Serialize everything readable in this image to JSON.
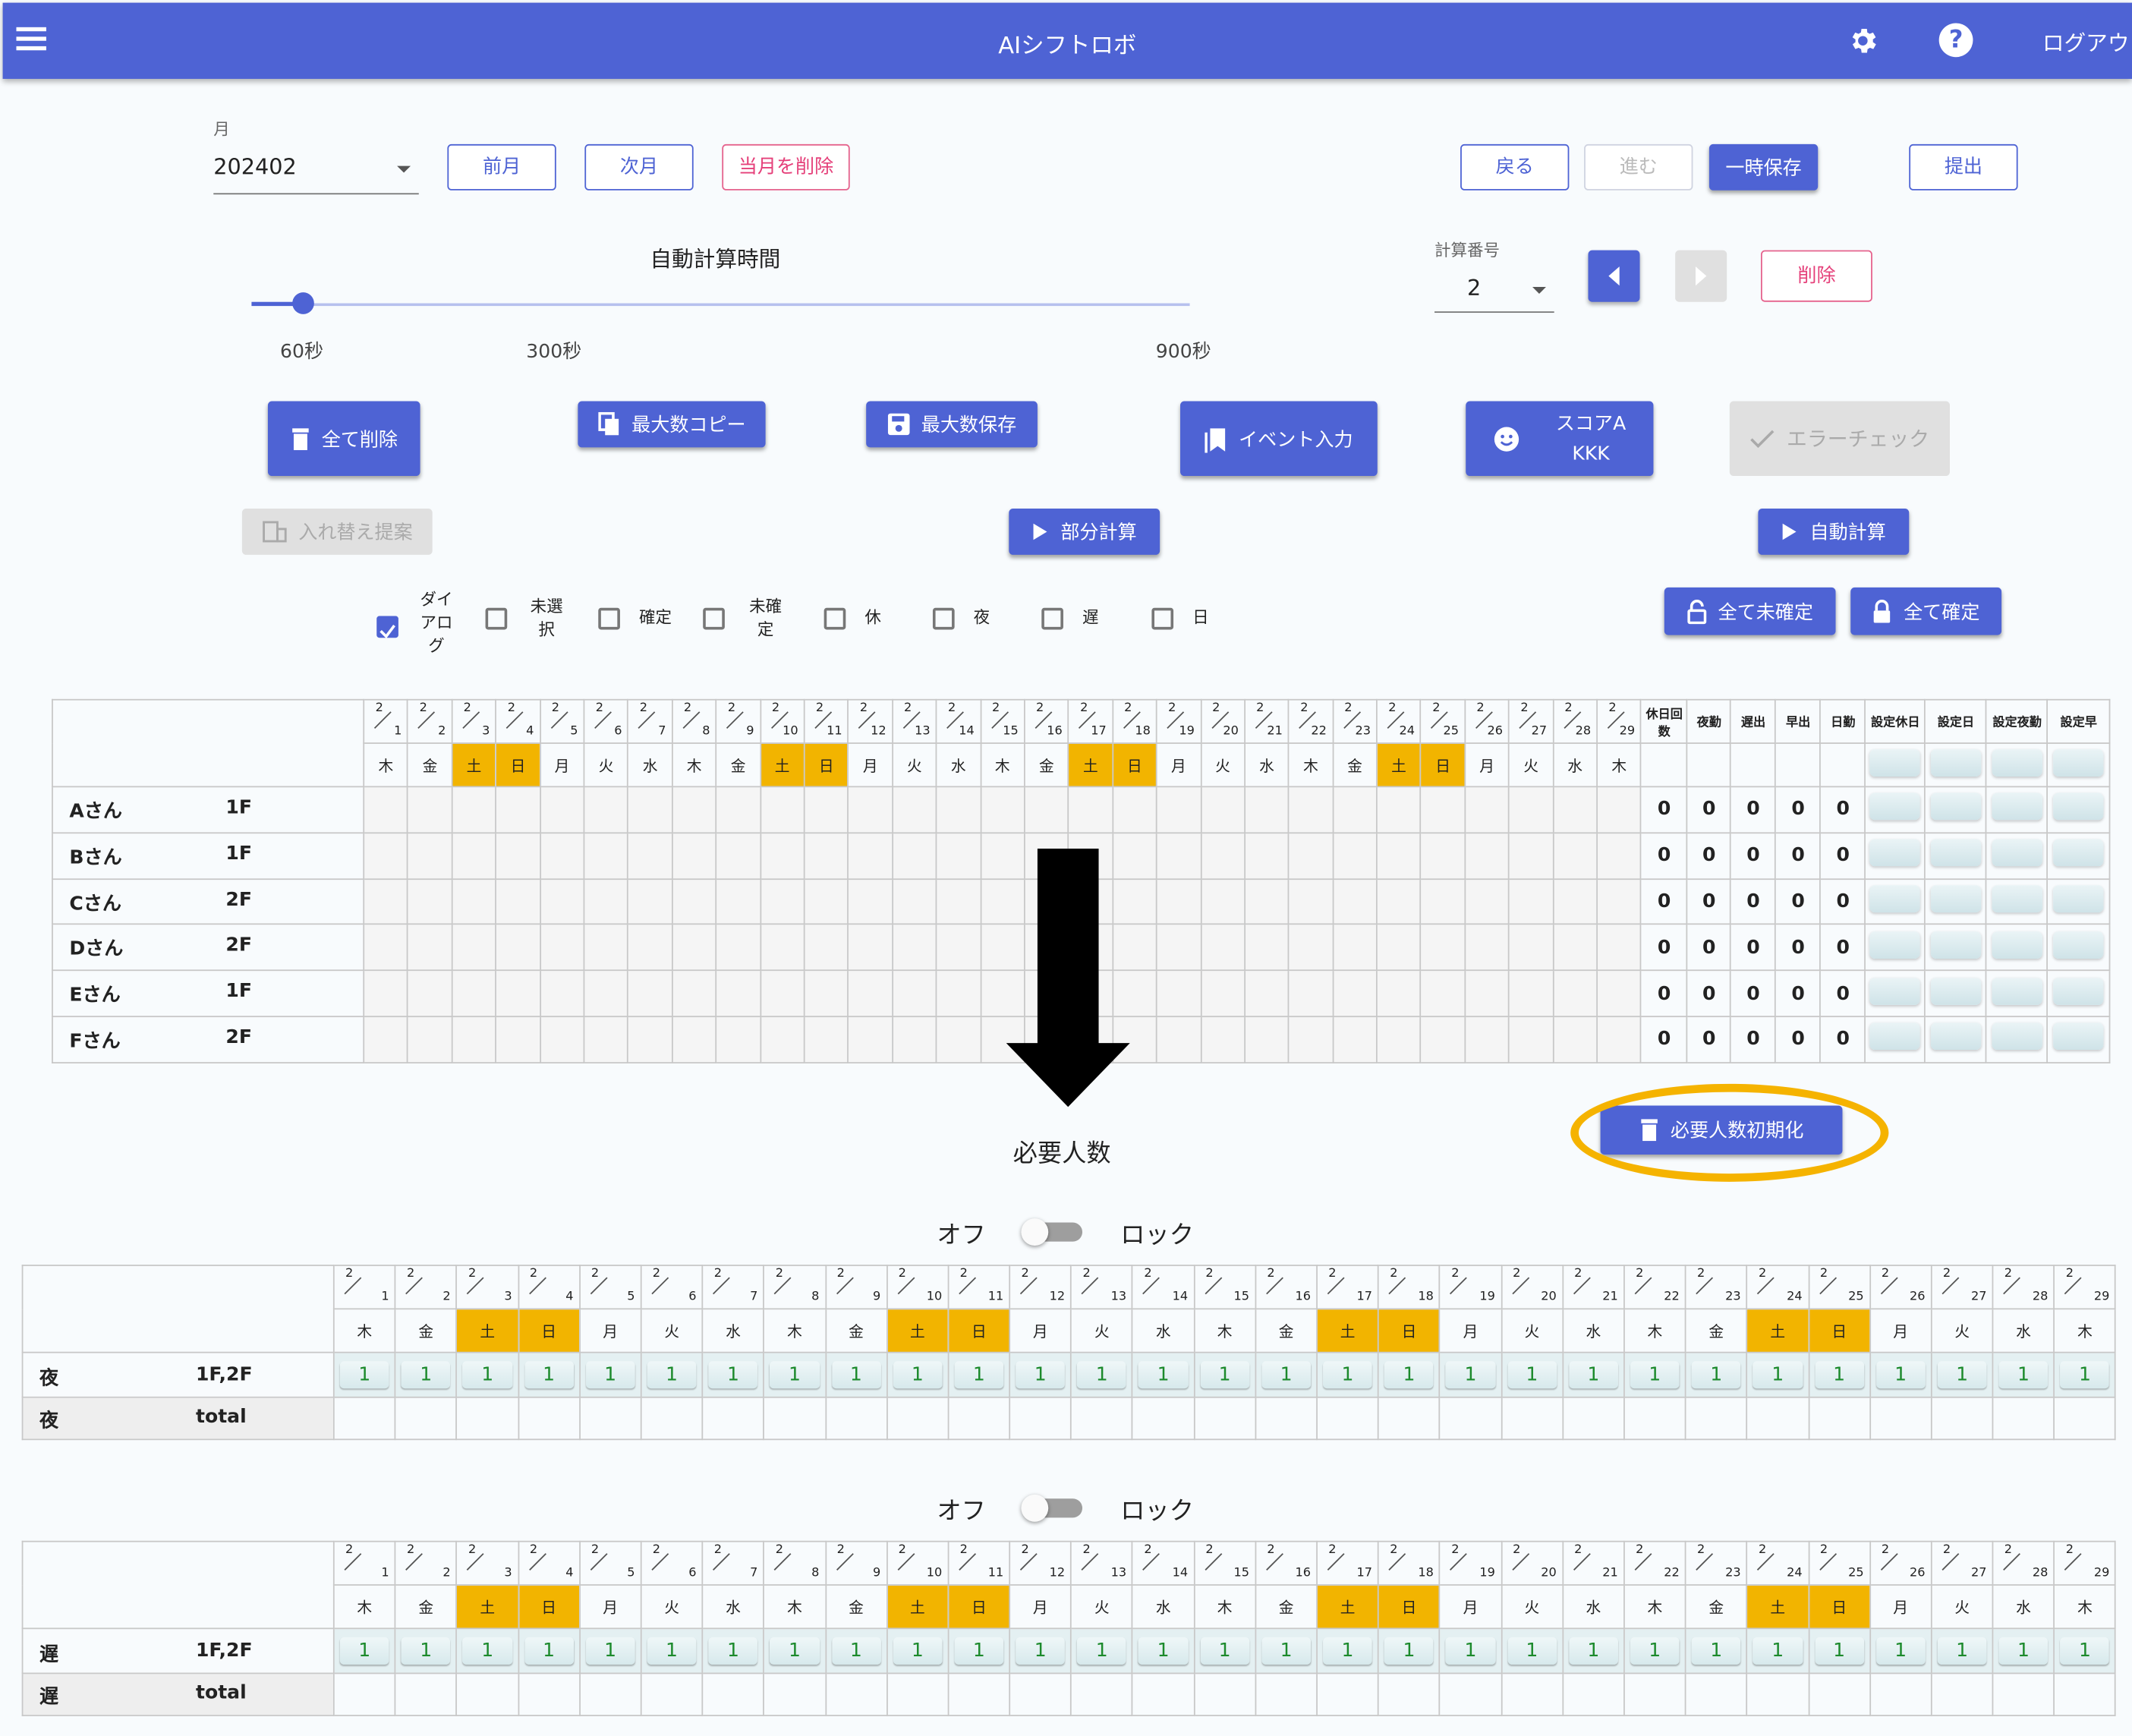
{
  "app": {
    "title": "AIシフトロボ",
    "logout": "ログアウ"
  },
  "month": {
    "label": "月",
    "value": "202402"
  },
  "buttons": {
    "prev_month": "前月",
    "next_month": "次月",
    "delete_month": "当月を削除",
    "back": "戻る",
    "forward": "進む",
    "save_temp": "一時保存",
    "submit": "提出",
    "delete_calc": "削除",
    "delete_all": "全て削除",
    "copy_max": "最大数コピー",
    "save_max": "最大数保存",
    "event_input": "イベント入力",
    "score_a": "スコアA",
    "score_b": "KKK",
    "error_check": "エラーチェック",
    "swap": "入れ替え提案",
    "partial_calc": "部分計算",
    "auto_calc": "自動計算",
    "all_unconfirm": "全て未確定",
    "all_confirm": "全て確定",
    "reset_required": "必要人数初期化"
  },
  "slider": {
    "title": "自動計算時間",
    "ticks": [
      "60秒",
      "300秒",
      "900秒"
    ],
    "value_sec": 60
  },
  "calc_no": {
    "label": "計算番号",
    "value": "2"
  },
  "filters": [
    {
      "label": "ダイアログ",
      "checked": true
    },
    {
      "label": "未選択",
      "checked": false
    },
    {
      "label": "確定",
      "checked": false
    },
    {
      "label": "未確定",
      "checked": false
    },
    {
      "label": "休",
      "checked": false
    },
    {
      "label": "夜",
      "checked": false
    },
    {
      "label": "遅",
      "checked": false
    },
    {
      "label": "日",
      "checked": false
    }
  ],
  "month_num": "2",
  "days": [
    {
      "d": "1",
      "w": "木"
    },
    {
      "d": "2",
      "w": "金"
    },
    {
      "d": "3",
      "w": "土",
      "we": true
    },
    {
      "d": "4",
      "w": "日",
      "we": true
    },
    {
      "d": "5",
      "w": "月"
    },
    {
      "d": "6",
      "w": "火"
    },
    {
      "d": "7",
      "w": "水"
    },
    {
      "d": "8",
      "w": "木"
    },
    {
      "d": "9",
      "w": "金"
    },
    {
      "d": "10",
      "w": "土",
      "we": true
    },
    {
      "d": "11",
      "w": "日",
      "we": true
    },
    {
      "d": "12",
      "w": "月"
    },
    {
      "d": "13",
      "w": "火"
    },
    {
      "d": "14",
      "w": "水"
    },
    {
      "d": "15",
      "w": "木"
    },
    {
      "d": "16",
      "w": "金"
    },
    {
      "d": "17",
      "w": "土",
      "we": true
    },
    {
      "d": "18",
      "w": "日",
      "we": true
    },
    {
      "d": "19",
      "w": "月"
    },
    {
      "d": "20",
      "w": "火"
    },
    {
      "d": "21",
      "w": "水"
    },
    {
      "d": "22",
      "w": "木"
    },
    {
      "d": "23",
      "w": "金"
    },
    {
      "d": "24",
      "w": "土",
      "we": true
    },
    {
      "d": "25",
      "w": "日",
      "we": true
    },
    {
      "d": "26",
      "w": "月"
    },
    {
      "d": "27",
      "w": "火"
    },
    {
      "d": "28",
      "w": "水"
    },
    {
      "d": "29",
      "w": "木"
    }
  ],
  "shift": {
    "stat_headers": [
      "休日回数",
      "夜勤",
      "遅出",
      "早出",
      "日勤"
    ],
    "setting_headers": [
      "設定休日",
      "設定日",
      "設定夜勤",
      "設定早"
    ],
    "staff": [
      {
        "name": "Aさん",
        "floor": "1F",
        "stats": [
          "0",
          "0",
          "0",
          "0",
          "0"
        ]
      },
      {
        "name": "Bさん",
        "floor": "1F",
        "stats": [
          "0",
          "0",
          "0",
          "0",
          "0"
        ]
      },
      {
        "name": "Cさん",
        "floor": "2F",
        "stats": [
          "0",
          "0",
          "0",
          "0",
          "0"
        ]
      },
      {
        "name": "Dさん",
        "floor": "2F",
        "stats": [
          "0",
          "0",
          "0",
          "0",
          "0"
        ]
      },
      {
        "name": "Eさん",
        "floor": "1F",
        "stats": [
          "0",
          "0",
          "0",
          "0",
          "0"
        ]
      },
      {
        "name": "Fさん",
        "floor": "2F",
        "stats": [
          "0",
          "0",
          "0",
          "0",
          "0"
        ]
      }
    ]
  },
  "required": {
    "title": "必要人数",
    "switch_off": "オフ",
    "switch_on": "ロック",
    "tables": [
      {
        "shift": "夜",
        "floors": "1F,2F",
        "total_label": "total",
        "value": "1"
      },
      {
        "shift": "遅",
        "floors": "1F,2F",
        "total_label": "total",
        "value": "1"
      }
    ]
  },
  "colors": {
    "primary": "#4e63d4",
    "weekend": "#f2b400",
    "highlight": "#f5b300"
  }
}
